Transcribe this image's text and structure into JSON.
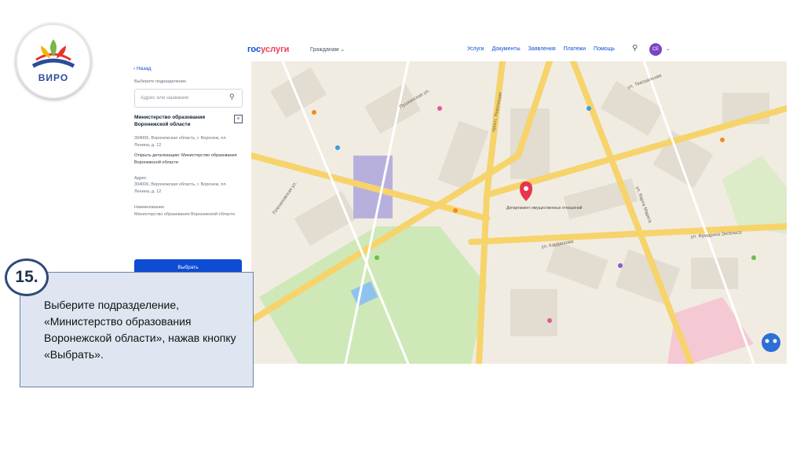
{
  "logo": {
    "text": "ВИРО"
  },
  "portal": {
    "brand_part1": "гос",
    "brand_part2": "услуги",
    "citizens_label": "Гражданам ⌄",
    "nav": [
      "Услуги",
      "Документы",
      "Заявления",
      "Платежи",
      "Помощь"
    ],
    "avatar_initials": "СЕ"
  },
  "panel": {
    "back_label": "‹ Назад",
    "choose_label": "Выберите подразделение",
    "search_placeholder": "Адрес или название",
    "org_title": "Министерство образования Воронежской области",
    "org_address": "394006, Воронежская область, г. Воронеж, пл. Ленина, д. 12",
    "details_link": "Открыть детализацию: Министерство образования Воронежской области",
    "address_label": "Адрес",
    "address_value": "394006, Воронежская область, г. Воронеж, пл. Ленина, д. 12",
    "name_label": "Наименование",
    "name_value": "Министерство образования Воронежской области",
    "select_button": "Выбрать"
  },
  "map": {
    "streets": [
      "Пушкинская ул.",
      "Плехановская ул.",
      "ул. Карла Маркса",
      "ул. Кардашова",
      "ул. Фридриха Энгельса",
      "просп. Революции",
      "ул. Театральная"
    ],
    "selected_place": "Департамент имущественных отношений"
  },
  "instruction": {
    "step": "15.",
    "text": "Выберите подразделение, «Министерство образования Воронежской области», нажав кнопку «Выбрать»."
  }
}
